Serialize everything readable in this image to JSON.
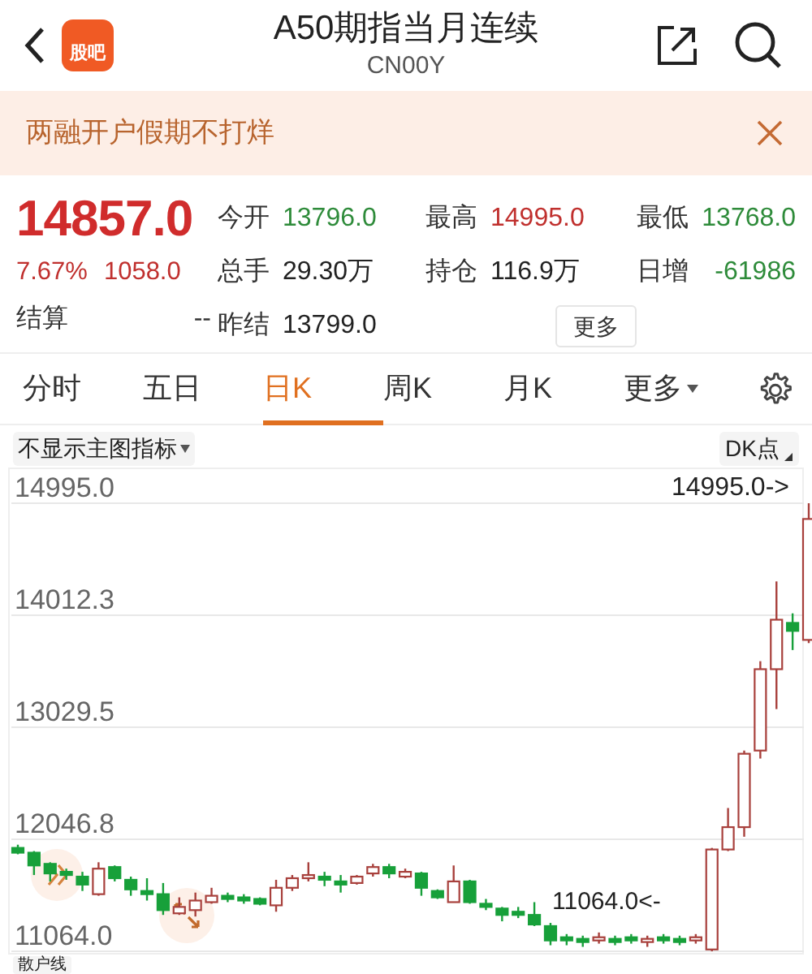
{
  "header": {
    "logo_text": "股吧",
    "title": "A50期指当月连续",
    "subtitle": "CN00Y"
  },
  "banner": {
    "text": "两融开户假期不打烊"
  },
  "quote": {
    "price": "14857.0",
    "change_pct": "7.67%",
    "change": "1058.0",
    "settle_label": "结算",
    "settle_value": "--",
    "more_button": "更多",
    "stats": [
      {
        "label": "今开",
        "value": "13796.0",
        "color": "#2e8b3a"
      },
      {
        "label": "最高",
        "value": "14995.0",
        "color": "#c0302e"
      },
      {
        "label": "最低",
        "value": "13768.0",
        "color": "#2e8b3a"
      },
      {
        "label": "总手",
        "value": "29.30万",
        "color": "#222222"
      },
      {
        "label": "持仓",
        "value": "116.9万",
        "color": "#222222"
      },
      {
        "label": "日增",
        "value": "-61986",
        "color": "#2e8b3a"
      },
      {
        "label": "昨结",
        "value": "13799.0",
        "color": "#222222"
      }
    ]
  },
  "tabs": [
    {
      "label": "分时",
      "selected": false
    },
    {
      "label": "五日",
      "selected": false
    },
    {
      "label": "日K",
      "selected": true
    },
    {
      "label": "周K",
      "selected": false
    },
    {
      "label": "月K",
      "selected": false
    },
    {
      "label": "更多",
      "selected": false,
      "kind": "dropdown"
    }
  ],
  "chart": {
    "indicator_select": "不显示主图指标",
    "dk_button": "DK点",
    "chart_data": {
      "type": "candlestick",
      "grid": true,
      "ylim": [
        11064,
        14995
      ],
      "yticks": [
        {
          "value": 14995,
          "label": "14995.0"
        },
        {
          "value": 14012.3,
          "label": "14012.3"
        },
        {
          "value": 13029.5,
          "label": "13029.5"
        },
        {
          "value": 12046.8,
          "label": "12046.8"
        },
        {
          "value": 11064,
          "label": "11064.0"
        }
      ],
      "ohlc": [
        [
          11971,
          11999,
          11915,
          11929
        ],
        [
          11929,
          11943,
          11733,
          11817
        ],
        [
          11831,
          11845,
          11677,
          11747
        ],
        [
          11761,
          11789,
          11691,
          11733
        ],
        [
          11719,
          11761,
          11593,
          11649
        ],
        [
          11565,
          11845,
          11551,
          11789
        ],
        [
          11803,
          11817,
          11677,
          11705
        ],
        [
          11691,
          11719,
          11551,
          11607
        ],
        [
          11593,
          11705,
          11509,
          11565
        ],
        [
          11565,
          11663,
          11383,
          11425
        ],
        [
          11397,
          11537,
          11383,
          11453
        ],
        [
          11425,
          11579,
          11369,
          11509
        ],
        [
          11495,
          11621,
          11481,
          11551
        ],
        [
          11551,
          11579,
          11495,
          11523
        ],
        [
          11537,
          11565,
          11481,
          11509
        ],
        [
          11523,
          11537,
          11467,
          11481
        ],
        [
          11467,
          11691,
          11411,
          11621
        ],
        [
          11621,
          11733,
          11593,
          11705
        ],
        [
          11705,
          11845,
          11677,
          11733
        ],
        [
          11719,
          11761,
          11635,
          11691
        ],
        [
          11677,
          11733,
          11579,
          11649
        ],
        [
          11663,
          11733,
          11649,
          11719
        ],
        [
          11747,
          11831,
          11719,
          11803
        ],
        [
          11803,
          11831,
          11705,
          11747
        ],
        [
          11719,
          11789,
          11705,
          11761
        ],
        [
          11747,
          11761,
          11551,
          11621
        ],
        [
          11593,
          11607,
          11523,
          11537
        ],
        [
          11495,
          11817,
          11495,
          11677
        ],
        [
          11677,
          11691,
          11481,
          11495
        ],
        [
          11481,
          11523,
          11425,
          11453
        ],
        [
          11439,
          11453,
          11327,
          11383
        ],
        [
          11411,
          11453,
          11355,
          11383
        ],
        [
          11383,
          11495,
          11285,
          11299
        ],
        [
          11285,
          11313,
          11117,
          11159
        ],
        [
          11187,
          11215,
          11117,
          11159
        ],
        [
          11173,
          11201,
          11103,
          11145
        ],
        [
          11159,
          11229,
          11131,
          11187
        ],
        [
          11173,
          11201,
          11117,
          11145
        ],
        [
          11187,
          11215,
          11131,
          11159
        ],
        [
          11145,
          11201,
          11103,
          11173
        ],
        [
          11187,
          11215,
          11131,
          11159
        ],
        [
          11173,
          11201,
          11117,
          11145
        ],
        [
          11159,
          11215,
          11131,
          11187
        ],
        [
          11080,
          11971,
          11064,
          11957
        ],
        [
          11957,
          12321,
          11943,
          12153
        ],
        [
          12153,
          12825,
          12069,
          12797
        ],
        [
          12825,
          13609,
          12755,
          13539
        ],
        [
          13539,
          14309,
          13189,
          13973
        ],
        [
          13945,
          14029,
          13707,
          13875
        ],
        [
          13796,
          14995,
          13768,
          14857
        ]
      ]
    },
    "high_marker": "14995.0->",
    "low_marker": "11064.0<-",
    "bottom_chip": "散户线"
  }
}
